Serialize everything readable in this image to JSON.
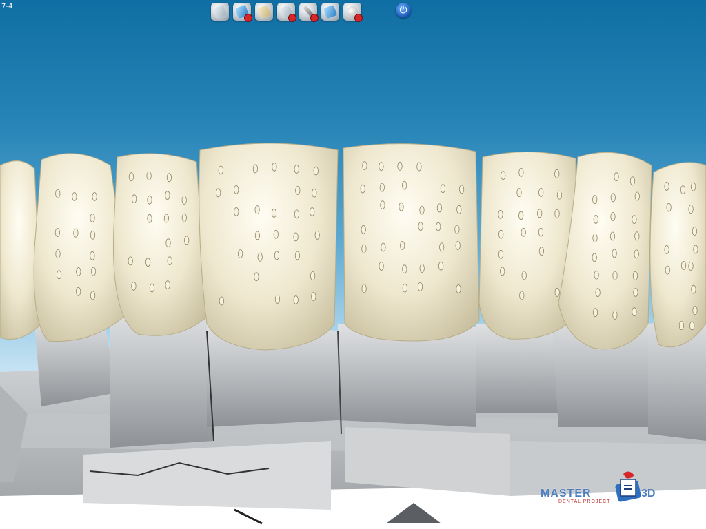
{
  "app": {
    "corner_label": "7-4"
  },
  "toolbar": {
    "buttons": [
      {
        "icon": "model-import-icon"
      },
      {
        "icon": "scan-delete-icon"
      },
      {
        "icon": "crown-export-icon"
      },
      {
        "icon": "tooth-delete-icon"
      },
      {
        "icon": "tool-delete-icon"
      },
      {
        "icon": "layer-tool-icon"
      },
      {
        "icon": "head-delete-icon"
      }
    ],
    "power_icon": "power-icon",
    "power_glyph": "⏻"
  },
  "logo": {
    "brand_left": "MASTER",
    "brand_right": "3D",
    "tagline": "DENTAL PROJECT"
  },
  "colors": {
    "sky_top": "#0f6ea3",
    "tooth_enamel": "#efe8cf",
    "stump_gray": "#b9bcbf",
    "accent_red": "#d7262a",
    "power_blue": "#1b55b4"
  }
}
